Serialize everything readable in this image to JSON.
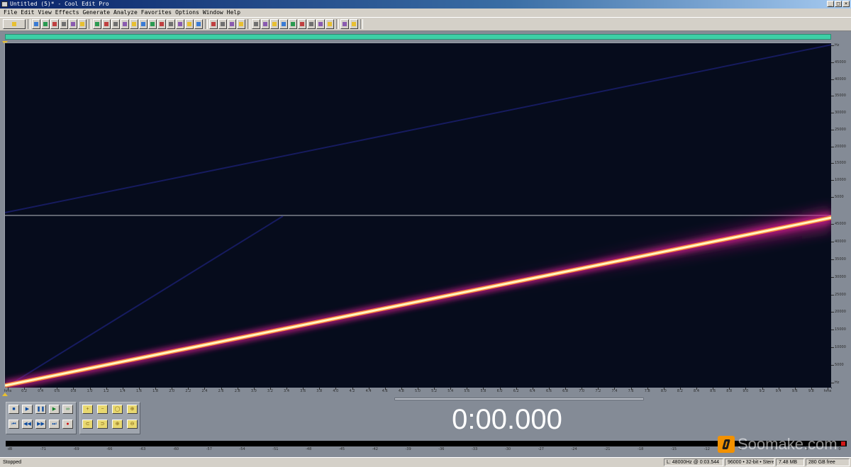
{
  "window": {
    "title": "Untitled (5)* - Cool Edit Pro",
    "buttons": [
      "_",
      "□",
      "×"
    ]
  },
  "menu": [
    "File",
    "Edit",
    "View",
    "Effects",
    "Generate",
    "Analyze",
    "Favorites",
    "Options",
    "Window",
    "Help"
  ],
  "colors": {
    "overview": "#3ccfa6",
    "spectral_background": "#060c1c",
    "sweep_core": "#fff6c0",
    "sweep_glow": "#d01e8e"
  },
  "freq_ruler": {
    "top_channel": [
      "Hz",
      "45000",
      "40000",
      "35000",
      "30000",
      "25000",
      "20000",
      "15000",
      "10000",
      "5000"
    ],
    "bottom_channel": [
      "45000",
      "40000",
      "35000",
      "30000",
      "25000",
      "20000",
      "15000",
      "10000",
      "5000",
      "Hz"
    ]
  },
  "time_ruler": {
    "labels": [
      "hms",
      "0.2",
      "0.4",
      "0.6",
      "0.8",
      "1.0",
      "1.2",
      "1.4",
      "1.6",
      "1.8",
      "2.0",
      "2.2",
      "2.4",
      "2.6",
      "2.8",
      "3.0",
      "3.2",
      "3.4",
      "3.6",
      "3.8",
      "4.0",
      "4.2",
      "4.4",
      "4.6",
      "4.8",
      "5.0",
      "5.2",
      "5.4",
      "5.6",
      "5.8",
      "6.0",
      "6.2",
      "6.4",
      "6.6",
      "6.8",
      "7.0",
      "7.2",
      "7.4",
      "7.6",
      "7.8",
      "8.0",
      "8.2",
      "8.4",
      "8.6",
      "8.8",
      "9.0",
      "9.2",
      "9.4",
      "9.6",
      "9.8",
      "hms"
    ]
  },
  "transport": {
    "row1": [
      {
        "icon": "stop-icon",
        "glyph": "■"
      },
      {
        "icon": "play-icon",
        "glyph": "▶"
      },
      {
        "icon": "pause-icon",
        "glyph": "❚❚"
      },
      {
        "icon": "play-to-end-icon",
        "glyph": "▶"
      },
      {
        "icon": "loop-icon",
        "glyph": "∞"
      }
    ],
    "row2": [
      {
        "icon": "go-to-start-icon",
        "glyph": "⏮"
      },
      {
        "icon": "rewind-icon",
        "glyph": "◀◀"
      },
      {
        "icon": "fast-forward-icon",
        "glyph": "▶▶"
      },
      {
        "icon": "go-to-end-icon",
        "glyph": "⏭"
      },
      {
        "icon": "record-icon",
        "glyph": "●"
      }
    ]
  },
  "zoom": {
    "row1": [
      {
        "icon": "zoom-in-icon",
        "glyph": "+"
      },
      {
        "icon": "zoom-out-icon",
        "glyph": "−"
      },
      {
        "icon": "zoom-full-icon",
        "glyph": "◯"
      },
      {
        "icon": "zoom-selection-icon",
        "glyph": "⊕"
      }
    ],
    "row2": [
      {
        "icon": "zoom-left-icon",
        "glyph": "⊂"
      },
      {
        "icon": "zoom-right-icon",
        "glyph": "⊃"
      },
      {
        "icon": "zoom-vertical-in-icon",
        "glyph": "⊕"
      },
      {
        "icon": "zoom-vertical-out-icon",
        "glyph": "⊖"
      }
    ]
  },
  "time_display": "0:00.000",
  "level_scale": [
    "dB",
    "-71",
    "-69",
    "-66",
    "-63",
    "-60",
    "-57",
    "-54",
    "-51",
    "-48",
    "-45",
    "-42",
    "-39",
    "-36",
    "-33",
    "-30",
    "-27",
    "-24",
    "-21",
    "-18",
    "-15",
    "-12",
    "-9",
    "-6",
    "-3",
    "0"
  ],
  "status": {
    "text": "Stopped",
    "cells": [
      "L: 48000Hz @ 0:03.544",
      "96000 • 32-bit • Stereo",
      "7.48 MB",
      "280 GB free"
    ]
  },
  "watermark": "Soomake.com"
}
